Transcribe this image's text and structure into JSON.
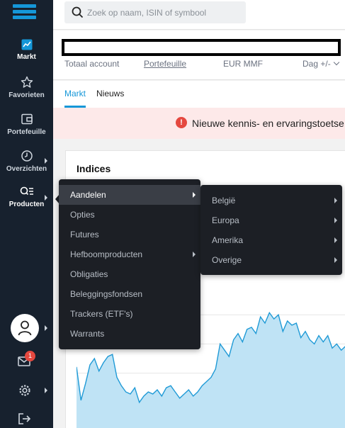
{
  "colors": {
    "accent": "#1597d8",
    "sidebar_bg": "#17212e",
    "menu_bg": "#1c1f25",
    "alert_bg": "#fde9e9",
    "alert_icon": "#e5483f",
    "chart_fill": "#bfe3f5",
    "chart_line": "#1f9ad6"
  },
  "sidebar": {
    "logo": "hamburger-logo",
    "items": [
      {
        "label": "Markt",
        "icon": "chart-icon"
      },
      {
        "label": "Favorieten",
        "icon": "star-icon"
      },
      {
        "label": "Portefeuille",
        "icon": "wallet-icon"
      },
      {
        "label": "Overzichten",
        "icon": "clock-icon"
      },
      {
        "label": "Producten",
        "icon": "products-icon"
      }
    ],
    "mail_badge": "1"
  },
  "search": {
    "placeholder": "Zoek op naam, ISIN of symbool"
  },
  "account": {
    "total": "Totaal account",
    "portfolio": "Portefeuille",
    "currency": "EUR MMF",
    "period": "Dag +/-"
  },
  "tabs": [
    {
      "label": "Markt"
    },
    {
      "label": "Nieuws"
    }
  ],
  "alert": {
    "text": "Nieuwe kennis- en ervaringstoetse"
  },
  "card": {
    "title": "Indices"
  },
  "menu": {
    "items": [
      {
        "label": "Aandelen"
      },
      {
        "label": "Opties"
      },
      {
        "label": "Futures"
      },
      {
        "label": "Hefboomproducten"
      },
      {
        "label": "Obligaties"
      },
      {
        "label": "Beleggingsfondsen"
      },
      {
        "label": "Trackers (ETF's)"
      },
      {
        "label": "Warrants"
      }
    ]
  },
  "submenu": {
    "items": [
      {
        "label": "België"
      },
      {
        "label": "Europa"
      },
      {
        "label": "Amerika"
      },
      {
        "label": "Overige"
      }
    ]
  },
  "chart_data": {
    "type": "area",
    "title": "",
    "xlabel": "",
    "ylabel": "",
    "x": [
      0,
      1,
      2,
      3,
      4,
      5,
      6,
      7,
      8,
      9,
      10,
      11,
      12,
      13,
      14,
      15,
      16,
      17,
      18,
      19,
      20,
      21,
      22,
      23,
      24,
      25,
      26,
      27,
      28,
      29,
      30,
      31,
      32,
      33,
      34,
      35,
      36,
      37,
      38,
      39,
      40,
      41,
      42,
      43,
      44,
      45,
      46,
      47,
      48,
      49,
      50,
      51,
      52,
      53,
      54,
      55,
      56,
      57,
      58,
      59,
      60
    ],
    "values": [
      62,
      30,
      46,
      64,
      70,
      58,
      66,
      72,
      74,
      52,
      44,
      38,
      36,
      42,
      28,
      34,
      38,
      36,
      40,
      34,
      42,
      44,
      38,
      32,
      36,
      40,
      34,
      38,
      44,
      48,
      52,
      60,
      84,
      78,
      72,
      88,
      94,
      86,
      98,
      100,
      94,
      110,
      104,
      114,
      108,
      112,
      96,
      106,
      102,
      104,
      90,
      96,
      88,
      84,
      92,
      86,
      92,
      80,
      84,
      78,
      82
    ],
    "ylim": [
      0,
      140
    ],
    "grid": true
  }
}
